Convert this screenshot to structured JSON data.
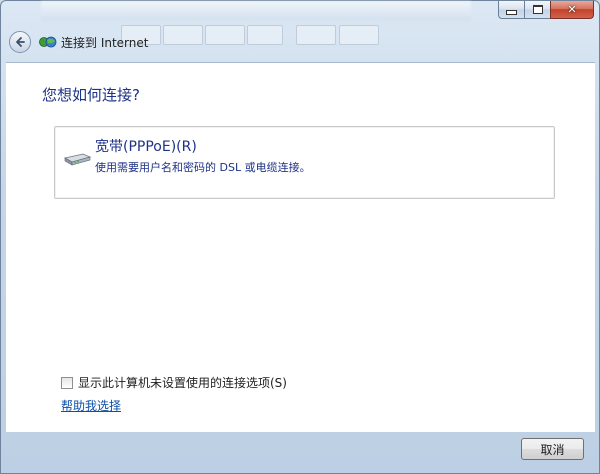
{
  "window": {
    "title": "连接到 Internet",
    "caption_close_glyph": "✕"
  },
  "page": {
    "question": "您想如何连接?"
  },
  "option_pppoe": {
    "title": "宽带(PPPoE)(R)",
    "description": "使用需要用户名和密码的 DSL 或电缆连接。"
  },
  "footer": {
    "checkbox_label": "显示此计算机未设置使用的连接选项(S)",
    "checkbox_checked": false,
    "help_link": "帮助我选择",
    "cancel_label": "取消"
  },
  "colors": {
    "heading_blue": "#1e3287",
    "link_blue": "#0c4fa6",
    "close_red": "#c2432b"
  },
  "icons": {
    "back": "back-arrow-icon",
    "app": "network-globe-icon",
    "option": "modem-icon"
  }
}
